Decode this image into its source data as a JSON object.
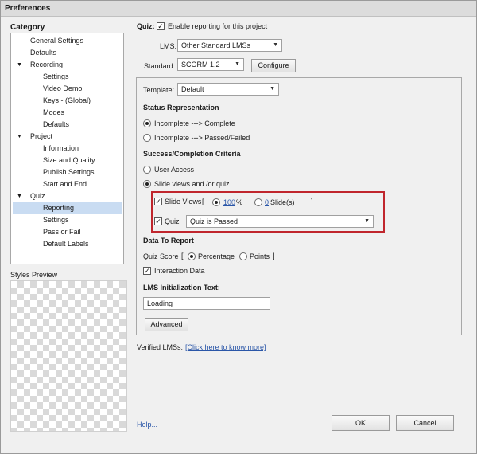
{
  "window": {
    "title": "Preferences"
  },
  "sidebar": {
    "title": "Category",
    "items": [
      {
        "label": "General Settings"
      },
      {
        "label": "Defaults"
      },
      {
        "label": "Recording"
      },
      {
        "label": "Settings"
      },
      {
        "label": "Video Demo"
      },
      {
        "label": "Keys - (Global)"
      },
      {
        "label": "Modes"
      },
      {
        "label": "Defaults"
      },
      {
        "label": "Project"
      },
      {
        "label": "Information"
      },
      {
        "label": "Size and Quality"
      },
      {
        "label": "Publish Settings"
      },
      {
        "label": "Start and End"
      },
      {
        "label": "Quiz"
      },
      {
        "label": "Reporting"
      },
      {
        "label": "Settings"
      },
      {
        "label": "Pass or Fail"
      },
      {
        "label": "Default Labels"
      }
    ],
    "styles_preview_label": "Styles Preview"
  },
  "main": {
    "quiz_label": "Quiz:",
    "enable_reporting_label": "Enable reporting for this project",
    "lms_label": "LMS:",
    "lms_value": "Other Standard LMSs",
    "standard_label": "Standard:",
    "standard_value": "SCORM 1.2",
    "configure_label": "Configure",
    "template_label": "Template:",
    "template_value": "Default",
    "status_heading": "Status Representation",
    "status_option_1": "Incomplete ---> Complete",
    "status_option_2": "Incomplete ---> Passed/Failed",
    "criteria_heading": "Success/Completion Criteria",
    "criteria_user_access": "User Access",
    "criteria_slide_views_quiz": "Slide views and /or quiz",
    "slide_views_label": "Slide Views",
    "bracket_open": "[",
    "bracket_close": "]",
    "percent_value": "100",
    "percent_sign": "%",
    "slides_value": "0",
    "slides_label": "Slide(s)",
    "quiz_check_label": "Quiz",
    "quiz_condition_value": "Quiz is Passed",
    "data_heading": "Data To Report",
    "quiz_score_label": "Quiz Score",
    "percentage_label": "Percentage",
    "points_label": "Points",
    "interaction_data_label": "Interaction Data",
    "lms_init_heading": "LMS Initialization Text:",
    "lms_init_value": "Loading",
    "advanced_label": "Advanced",
    "verified_label": "Verified LMSs:",
    "verified_link": "[Click here to know more]",
    "checkmark": "✓"
  },
  "footer": {
    "help_label": "Help...",
    "ok_label": "OK",
    "cancel_label": "Cancel"
  }
}
